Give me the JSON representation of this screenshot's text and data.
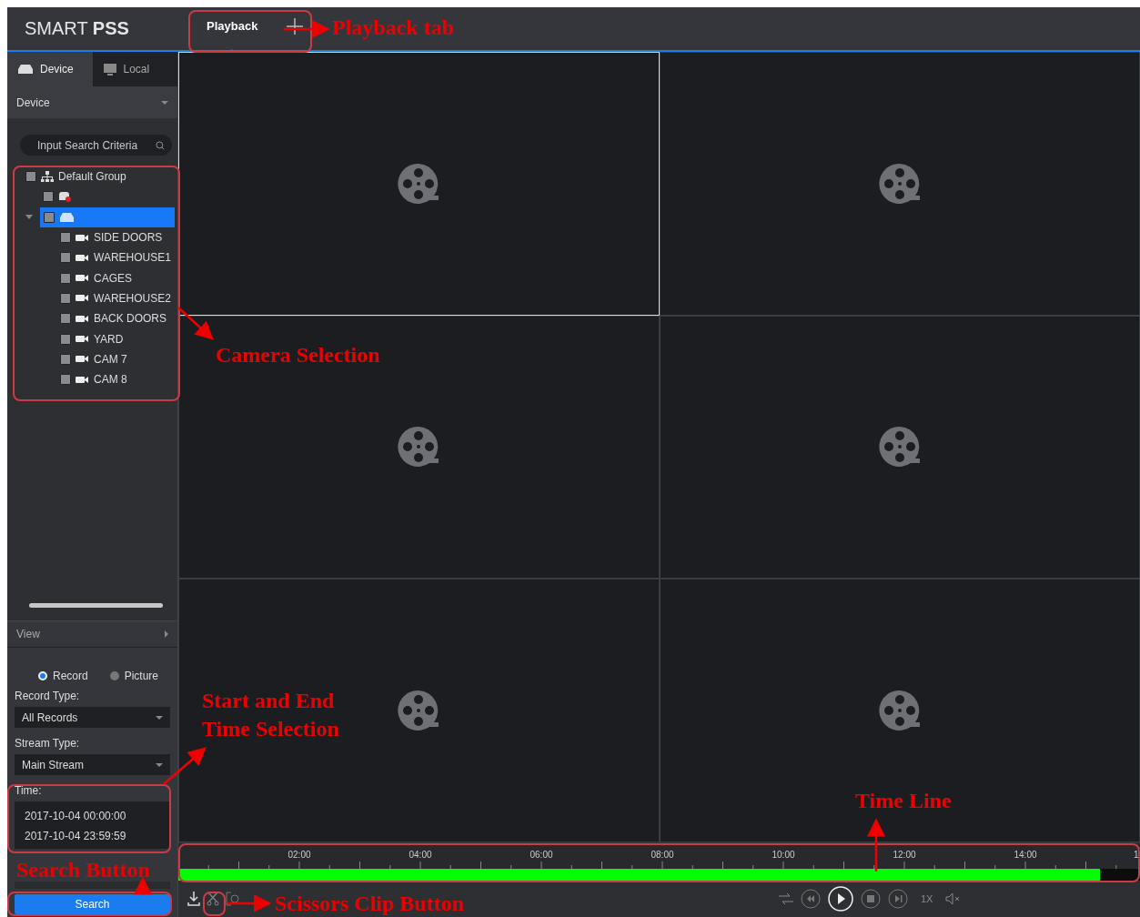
{
  "header": {
    "logo_light": "SMART",
    "logo_bold": "PSS",
    "tabs": [
      {
        "label": "Playback",
        "selected": true
      }
    ]
  },
  "sidebar": {
    "tabs": [
      {
        "label": "Device",
        "selected": true
      },
      {
        "label": "Local",
        "selected": false
      }
    ],
    "dropdown": "Device",
    "search": {
      "placeholder": "Input Search Criteria"
    },
    "tree": [
      {
        "kind": "group",
        "label": "Default Group",
        "checked": false,
        "selected": false,
        "children": [
          {
            "kind": "offline-device",
            "checked": false,
            "selected": false
          },
          {
            "kind": "device",
            "checked": false,
            "selected": true,
            "expanded": true,
            "children": [
              {
                "kind": "camera",
                "label": "SIDE DOORS",
                "checked": false,
                "selected": false
              },
              {
                "kind": "camera",
                "label": "WAREHOUSE1",
                "checked": false,
                "selected": false
              },
              {
                "kind": "camera",
                "label": "CAGES",
                "checked": false,
                "selected": false
              },
              {
                "kind": "camera",
                "label": "WAREHOUSE2",
                "checked": false,
                "selected": false
              },
              {
                "kind": "camera",
                "label": "BACK DOORS",
                "checked": false,
                "selected": false
              },
              {
                "kind": "camera",
                "label": "YARD",
                "checked": false,
                "selected": false
              },
              {
                "kind": "camera",
                "label": "CAM 7",
                "checked": false,
                "selected": false
              },
              {
                "kind": "camera",
                "label": "CAM 8",
                "checked": false,
                "selected": false
              }
            ]
          }
        ]
      }
    ],
    "view": "View",
    "modes": [
      {
        "label": "Record",
        "selected": true
      },
      {
        "label": "Picture",
        "selected": false
      }
    ],
    "record_type": {
      "label": "Record Type:",
      "value": "All Records"
    },
    "stream_type": {
      "label": "Stream Type:",
      "value": "Main Stream"
    },
    "time": {
      "label": "Time:",
      "start": "2017-10-04 00:00:00",
      "end": "2017-10-04 23:59:59"
    },
    "search_button": "Search"
  },
  "video_grid": [
    {
      "selected": true
    },
    {
      "selected": false
    },
    {
      "selected": false
    },
    {
      "selected": false
    },
    {
      "selected": false
    },
    {
      "selected": false
    }
  ],
  "timeline": {
    "ticks": [
      "02:00",
      "04:00",
      "06:00",
      "08:00",
      "10:00",
      "12:00",
      "14:00",
      "1"
    ],
    "level": 0.958
  },
  "controls": {
    "speed": "1X"
  },
  "annotations": [
    {
      "text": "Playback tab"
    },
    {
      "text": "Camera Selection"
    },
    {
      "text": "Start and End\nTime Selection"
    },
    {
      "text": "Time Line"
    },
    {
      "text": "Search Button"
    },
    {
      "text": "Scissors Clip Button"
    }
  ]
}
